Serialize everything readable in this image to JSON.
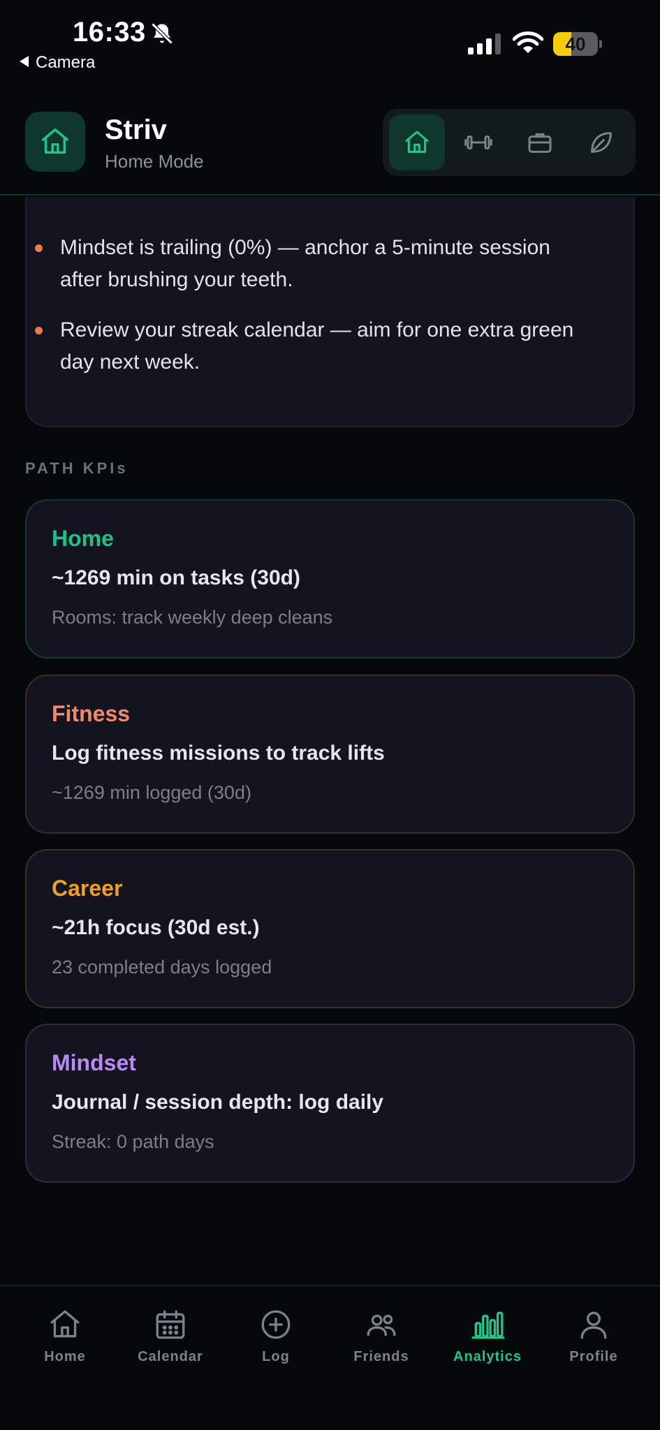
{
  "status_bar": {
    "time": "16:33",
    "back_app": "Camera",
    "battery_level": "40",
    "battery_fraction": 0.4
  },
  "header": {
    "app_name": "Striv",
    "mode_label": "Home Mode",
    "modes": [
      "home-icon",
      "dumbbell-icon",
      "briefcase-icon",
      "leaf-icon"
    ],
    "active_mode": "home"
  },
  "insights": [
    "Mindset is trailing (0%) — anchor a 5-minute session after brushing your teeth.",
    "Review your streak calendar — aim for one extra green day next week."
  ],
  "section_title": "PATH KPIs",
  "kpis": [
    {
      "name": "Home",
      "main": "~1269 min on tasks (30d)",
      "sub": "Rooms: track weekly deep cleans",
      "color": "#1fbf86",
      "border": "#173a30"
    },
    {
      "name": "Fitness",
      "main": "Log fitness missions to track lifts",
      "sub": "~1269 min logged (30d)",
      "color": "#f08a6c",
      "border": "#3b2a27"
    },
    {
      "name": "Career",
      "main": "~21h focus (30d est.)",
      "sub": "23 completed days logged",
      "color": "#f29e1f",
      "border": "#3a3122"
    },
    {
      "name": "Mindset",
      "main": "Journal / session depth: log daily",
      "sub": "Streak: 0 path days",
      "color": "#b98cf0",
      "border": "#2b2a40"
    }
  ],
  "tabs": [
    {
      "label": "Home",
      "icon": "home-icon"
    },
    {
      "label": "Calendar",
      "icon": "calendar-icon"
    },
    {
      "label": "Log",
      "icon": "plus-circle-icon"
    },
    {
      "label": "Friends",
      "icon": "friends-icon"
    },
    {
      "label": "Analytics",
      "icon": "bar-chart-icon"
    },
    {
      "label": "Profile",
      "icon": "profile-icon"
    }
  ],
  "active_tab": "Analytics",
  "colors": {
    "accent": "#22c58a",
    "background": "#06090b",
    "card": "#141420",
    "bullet": "#ef7a44"
  }
}
